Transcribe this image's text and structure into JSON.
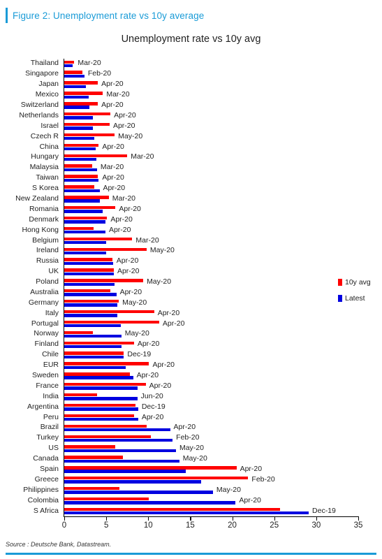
{
  "figure": {
    "header_title": "Figure 2: Unemployment rate vs 10y average",
    "accent_color": "#1a9bd7",
    "source": "Source : Deutsche Bank, Datastream."
  },
  "legend": {
    "position": "right-middle",
    "items": [
      {
        "label": "10y avg",
        "color": "#FF0000"
      },
      {
        "label": "Latest",
        "color": "#0000E0"
      }
    ]
  },
  "chart_data": {
    "type": "bar",
    "orientation": "horizontal",
    "title": "Unemployment rate vs 10y avg",
    "xlabel": "",
    "ylabel": "",
    "xlim": [
      0,
      35
    ],
    "xticks": [
      0,
      5,
      10,
      15,
      20,
      25,
      30,
      35
    ],
    "grid": false,
    "legend_position": "right",
    "series": [
      {
        "name": "10y avg",
        "color": "#FF0000"
      },
      {
        "name": "Latest",
        "color": "#0000E0"
      }
    ],
    "categories": [
      "Thailand",
      "Singapore",
      "Japan",
      "Mexico",
      "Switzerland",
      "Netherlands",
      "Israel",
      "Czech R",
      "China",
      "Hungary",
      "Malaysia",
      "Taiwan",
      "S Korea",
      "New Zealand",
      "Romania",
      "Denmark",
      "Hong Kong",
      "Belgium",
      "Ireland",
      "Russia",
      "UK",
      "Poland",
      "Australia",
      "Germany",
      "Italy",
      "Portugal",
      "Norway",
      "Finland",
      "Chile",
      "EUR",
      "Sweden",
      "France",
      "India",
      "Argentina",
      "Peru",
      "Brazil",
      "Turkey",
      "US",
      "Canada",
      "Spain",
      "Greece",
      "Philippines",
      "Colombia",
      "S Africa"
    ],
    "avg_10y": [
      1.2,
      2.2,
      4.0,
      4.6,
      4.0,
      5.5,
      5.4,
      6.0,
      4.1,
      7.5,
      3.3,
      4.0,
      3.6,
      5.3,
      6.1,
      5.1,
      3.5,
      8.1,
      9.8,
      5.7,
      5.9,
      9.4,
      5.5,
      6.5,
      10.7,
      11.3,
      3.4,
      8.3,
      7.1,
      10.1,
      7.8,
      9.7,
      3.9,
      8.5,
      8.3,
      9.8,
      10.3,
      6.1,
      7.0,
      20.5,
      21.9,
      6.6,
      10.1,
      25.7
    ],
    "latest": [
      1.0,
      2.4,
      2.6,
      2.9,
      3.0,
      3.4,
      3.4,
      3.6,
      3.7,
      3.8,
      3.9,
      4.1,
      4.2,
      4.2,
      4.6,
      4.9,
      4.9,
      5.0,
      5.0,
      5.8,
      5.9,
      6.0,
      6.2,
      6.3,
      6.3,
      6.7,
      6.8,
      6.8,
      7.1,
      7.3,
      8.2,
      8.7,
      8.7,
      8.8,
      8.8,
      12.6,
      12.9,
      13.3,
      13.7,
      14.5,
      16.3,
      17.7,
      20.4,
      29.1
    ],
    "date_labels": [
      "Mar-20",
      "Feb-20",
      "Apr-20",
      "Mar-20",
      "Apr-20",
      "Apr-20",
      "Apr-20",
      "May-20",
      "Apr-20",
      "Mar-20",
      "Mar-20",
      "Apr-20",
      "Apr-20",
      "Mar-20",
      "Apr-20",
      "Apr-20",
      "Apr-20",
      "Mar-20",
      "May-20",
      "Apr-20",
      "Apr-20",
      "May-20",
      "Apr-20",
      "May-20",
      "Apr-20",
      "Apr-20",
      "May-20",
      "Apr-20",
      "Dec-19",
      "Apr-20",
      "Apr-20",
      "Apr-20",
      "Jun-20",
      "Dec-19",
      "Apr-20",
      "Apr-20",
      "Feb-20",
      "May-20",
      "May-20",
      "Apr-20",
      "Feb-20",
      "May-20",
      "Apr-20",
      "Dec-19"
    ]
  }
}
